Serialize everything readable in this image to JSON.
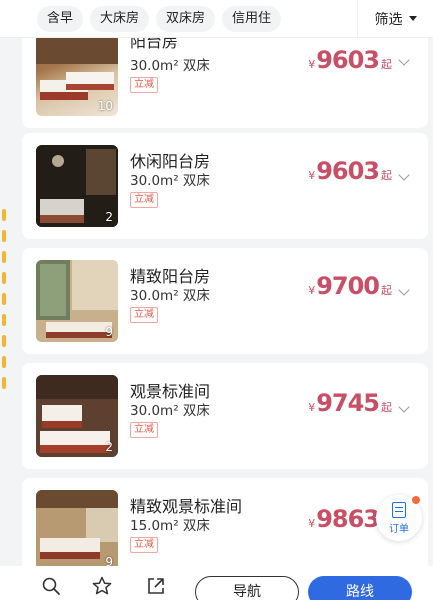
{
  "filters": {
    "chips": [
      "含早",
      "大床房",
      "双床房",
      "信用住"
    ],
    "filter_label": "筛选"
  },
  "rooms": [
    {
      "name": "阳台房",
      "spec": "30.0m² 双床",
      "promo": "立减",
      "currency": "¥",
      "price": "9603",
      "price_suffix": "起",
      "photos": "10"
    },
    {
      "name": "休闲阳台房",
      "spec": "30.0m² 双床",
      "promo": "立减",
      "currency": "¥",
      "price": "9603",
      "price_suffix": "起",
      "photos": "2"
    },
    {
      "name": "精致阳台房",
      "spec": "30.0m² 双床",
      "promo": "立减",
      "currency": "¥",
      "price": "9700",
      "price_suffix": "起",
      "photos": "9"
    },
    {
      "name": "观景标准间",
      "spec": "30.0m² 双床",
      "promo": "立减",
      "currency": "¥",
      "price": "9745",
      "price_suffix": "起",
      "photos": "2"
    },
    {
      "name": "精致观景标准间",
      "spec": "15.0m² 双床",
      "promo": "立减",
      "currency": "¥",
      "price": "9863",
      "price_suffix": "起",
      "photos": "9"
    }
  ],
  "order_fab": {
    "label": "订单"
  },
  "bottom_bar": {
    "navigate_label": "导航",
    "route_label": "路线"
  },
  "colors": {
    "price": "#c84f66",
    "primary": "#2f6ae0",
    "promo": "#e25a4c"
  }
}
